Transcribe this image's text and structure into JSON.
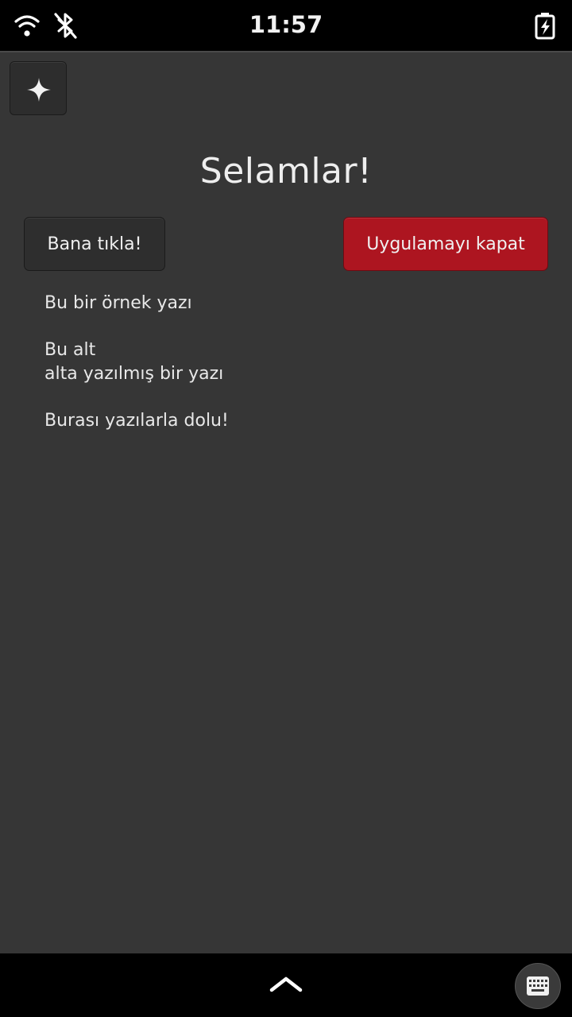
{
  "status_bar": {
    "time": "11:57",
    "icons": [
      "wifi-icon",
      "bluetooth-disabled-icon",
      "battery-charging-icon"
    ]
  },
  "app": {
    "menu_icon": "sparkle-icon",
    "headline": "Selamlar!",
    "buttons": {
      "click_label": "Bana tıkla!",
      "close_label": "Uygulamayı kapat",
      "close_color": "#ad1520"
    },
    "texts": {
      "sample": "Bu bir örnek yazı",
      "multiline_1": "Bu alt",
      "multiline_2": "alta yazılmış bir yazı",
      "full": "Burası yazılarla dolu!"
    }
  },
  "nav_bar": {
    "icons": [
      "chevron-up-icon",
      "keyboard-icon"
    ]
  }
}
